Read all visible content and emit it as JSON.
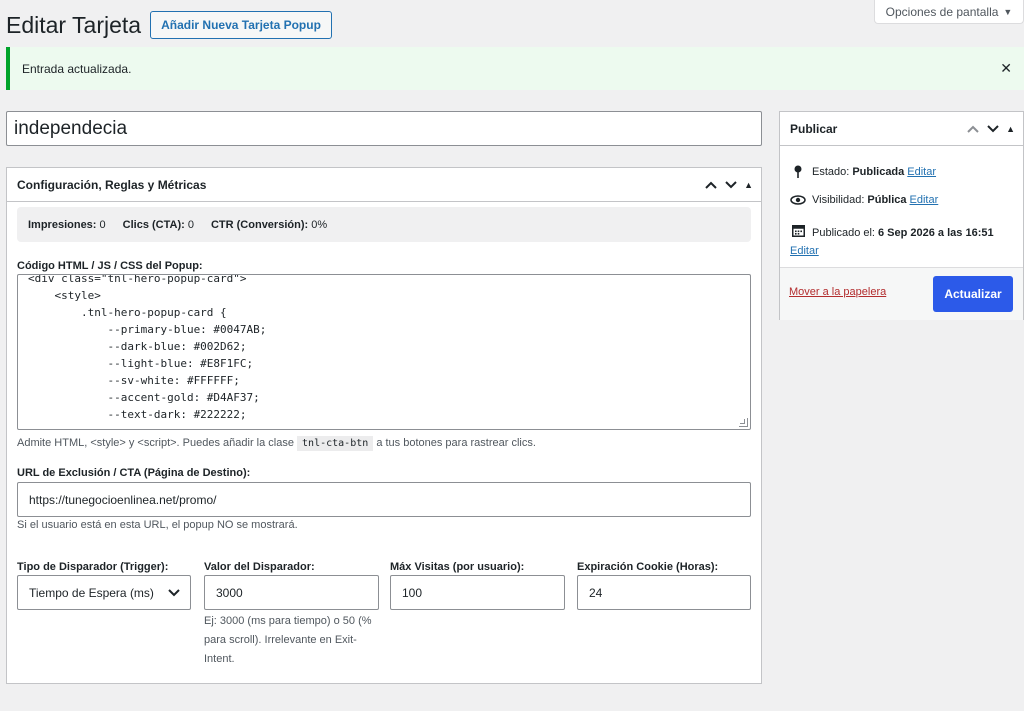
{
  "screen_options": {
    "label": "Opciones de pantalla"
  },
  "header": {
    "title": "Editar Tarjeta",
    "add_new_label": "Añadir Nueva Tarjeta Popup"
  },
  "notice": {
    "message": "Entrada actualizada."
  },
  "post_title": {
    "value": "independecia"
  },
  "metabox": {
    "title": "Configuración, Reglas y Métricas",
    "metrics": {
      "impressions_label": "Impresiones:",
      "impressions_value": "0",
      "clicks_label": "Clics (CTA):",
      "clicks_value": "0",
      "ctr_label": "CTR (Conversión):",
      "ctr_value": "0%"
    },
    "code_label": "Código HTML / JS / CSS del Popup:",
    "code_value": "<div class=\"tnl-hero-popup-card\">\n    <style>\n        .tnl-hero-popup-card {\n            --primary-blue: #0047AB;\n            --dark-blue: #002D62;\n            --light-blue: #E8F1FC;\n            --sv-white: #FFFFFF;\n            --accent-gold: #D4AF37;\n            --text-dark: #222222;",
    "code_help_before": "Admite HTML, <style> y <script>. Puedes añadir la clase",
    "code_help_class": "tnl-cta-btn",
    "code_help_after": "a tus botones para rastrear clics.",
    "url_label": "URL de Exclusión / CTA (Página de Destino):",
    "url_value": "https://tunegocioenlinea.net/promo/",
    "url_help": "Si el usuario está en esta URL, el popup NO se mostrará.",
    "trigger_type_label": "Tipo de Disparador (Trigger):",
    "trigger_type_value": "Tiempo de Espera (ms)",
    "trigger_value_label": "Valor del Disparador:",
    "trigger_value": "3000",
    "trigger_help": "Ej: 3000 (ms para tiempo) o 50 (% para scroll). Irrelevante en Exit-Intent.",
    "max_visits_label": "Máx Visitas (por usuario):",
    "max_visits_value": "100",
    "cookie_label": "Expiración Cookie (Horas):",
    "cookie_value": "24"
  },
  "publish": {
    "title": "Publicar",
    "status_label": "Estado:",
    "status_value": "Publicada",
    "visibility_label": "Visibilidad:",
    "visibility_value": "Pública",
    "published_label": "Publicado el:",
    "published_value": "6 Sep 2026 a las 16:51",
    "edit_label": "Editar",
    "trash_label": "Mover a la papelera",
    "update_label": "Actualizar"
  }
}
